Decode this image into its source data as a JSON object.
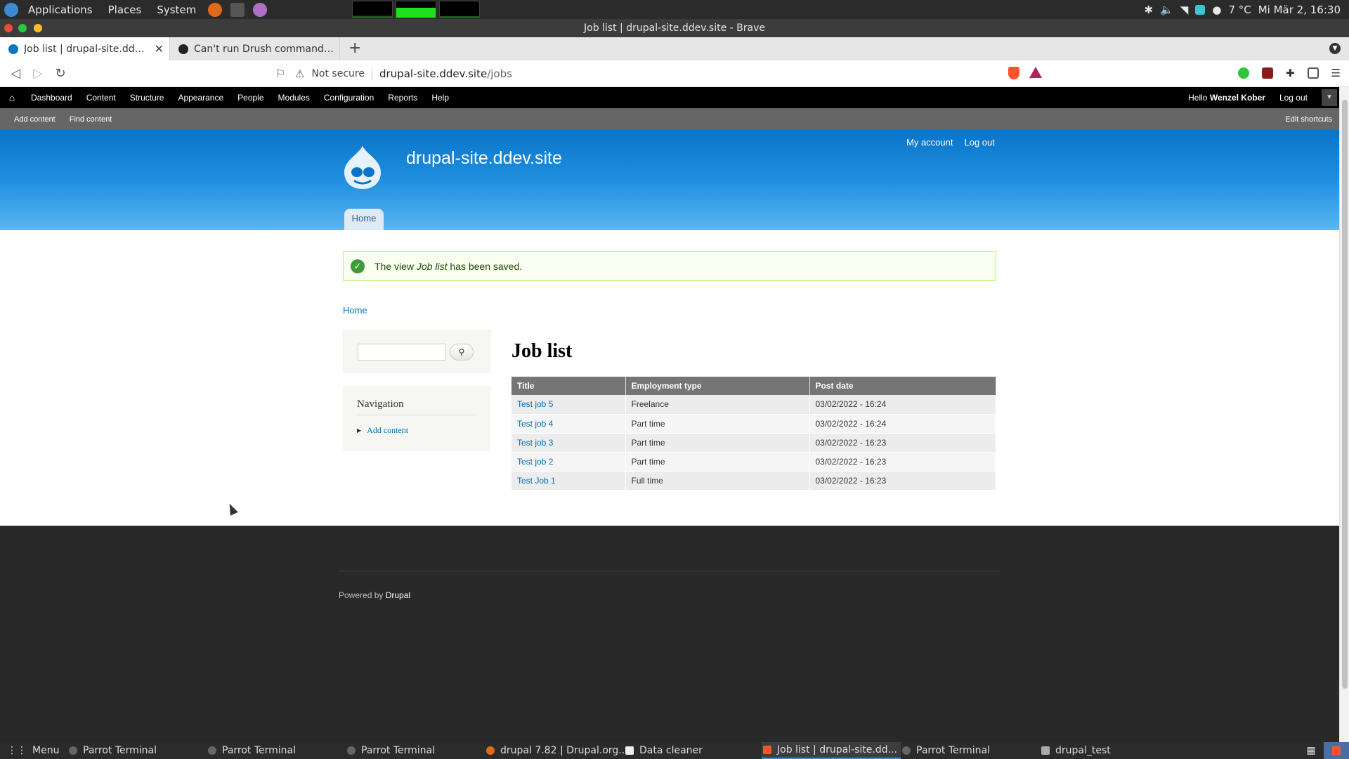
{
  "os_panel": {
    "menu": [
      "Applications",
      "Places",
      "System"
    ],
    "weather": "7 °C",
    "datetime": "Mi Mär  2, 16:30"
  },
  "window": {
    "title": "Job list | drupal-site.ddev.site - Brave"
  },
  "tabs": [
    {
      "label": "Job list | drupal-site.ddev.s",
      "active": true
    },
    {
      "label": "Can't run Drush commands fro",
      "active": false
    }
  ],
  "address_bar": {
    "security": "Not secure",
    "host": "drupal-site.ddev.site",
    "path": "/jobs"
  },
  "toolbar": {
    "items": [
      "Dashboard",
      "Content",
      "Structure",
      "Appearance",
      "People",
      "Modules",
      "Configuration",
      "Reports",
      "Help"
    ],
    "hello": "Hello",
    "user": "Wenzel Kober",
    "logout": "Log out"
  },
  "shortcuts": {
    "items": [
      "Add content",
      "Find content"
    ],
    "edit": "Edit shortcuts"
  },
  "header": {
    "site_name": "drupal-site.ddev.site",
    "links": [
      "My account",
      "Log out"
    ],
    "tab_home": "Home"
  },
  "message": {
    "prefix": "The view",
    "view_name": "Job list",
    "suffix": "has been saved."
  },
  "breadcrumb": "Home",
  "sidebar": {
    "nav_title": "Navigation",
    "nav_link": "Add content"
  },
  "main": {
    "title": "Job list",
    "columns": [
      "Title",
      "Employment type",
      "Post date"
    ],
    "rows": [
      [
        "Test job 5",
        "Freelance",
        "03/02/2022 - 16:24"
      ],
      [
        "Test job 4",
        "Part time",
        "03/02/2022 - 16:24"
      ],
      [
        "Test job 3",
        "Part time",
        "03/02/2022 - 16:23"
      ],
      [
        "Test job 2",
        "Part time",
        "03/02/2022 - 16:23"
      ],
      [
        "Test Job 1",
        "Full time",
        "03/02/2022 - 16:23"
      ]
    ]
  },
  "footer": {
    "powered": "Powered by",
    "drupal": "Drupal"
  },
  "taskbar": {
    "menu": "Menu",
    "tasks": [
      {
        "label": "Parrot Terminal",
        "icon": "terminal",
        "active": false
      },
      {
        "label": "Parrot Terminal",
        "icon": "terminal",
        "active": false
      },
      {
        "label": "Parrot Terminal",
        "icon": "terminal",
        "active": false
      },
      {
        "label": "drupal 7.82 | Drupal.org...",
        "icon": "firefox",
        "active": false
      },
      {
        "label": "Data cleaner",
        "icon": "app",
        "active": false
      },
      {
        "label": "Job list | drupal-site.dd...",
        "icon": "brave",
        "active": true
      },
      {
        "label": "Parrot Terminal",
        "icon": "terminal",
        "active": false
      },
      {
        "label": "drupal_test",
        "icon": "folder",
        "active": false
      }
    ]
  },
  "colors": {
    "link": "#0071b3",
    "header_gradient_top": "#0a74c6",
    "message_bg": "#f8fff0",
    "footer_bg": "#292929"
  }
}
